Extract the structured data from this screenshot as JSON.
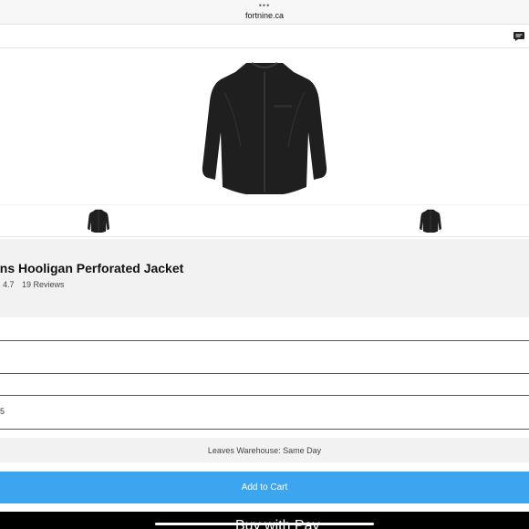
{
  "browser": {
    "dots": "•••",
    "domain": "fortnine.ca"
  },
  "icons": {
    "chat": "chat-icon",
    "jacket": "jacket-icon"
  },
  "product": {
    "title": "ens Hooligan Perforated Jacket",
    "rating": "4.7",
    "reviews": "19 Reviews"
  },
  "options": {
    "field1_value": "",
    "field2_value": "",
    "field3_value": "5"
  },
  "availability": {
    "text": "Leaves Warehouse: Same Day"
  },
  "cart": {
    "add_label": "Add to Cart",
    "pay_label": "Buy with  Pay"
  },
  "colors": {
    "accent": "#3ba6ef",
    "panel": "#f2f2f2",
    "jacket": "#1f1f1f"
  }
}
